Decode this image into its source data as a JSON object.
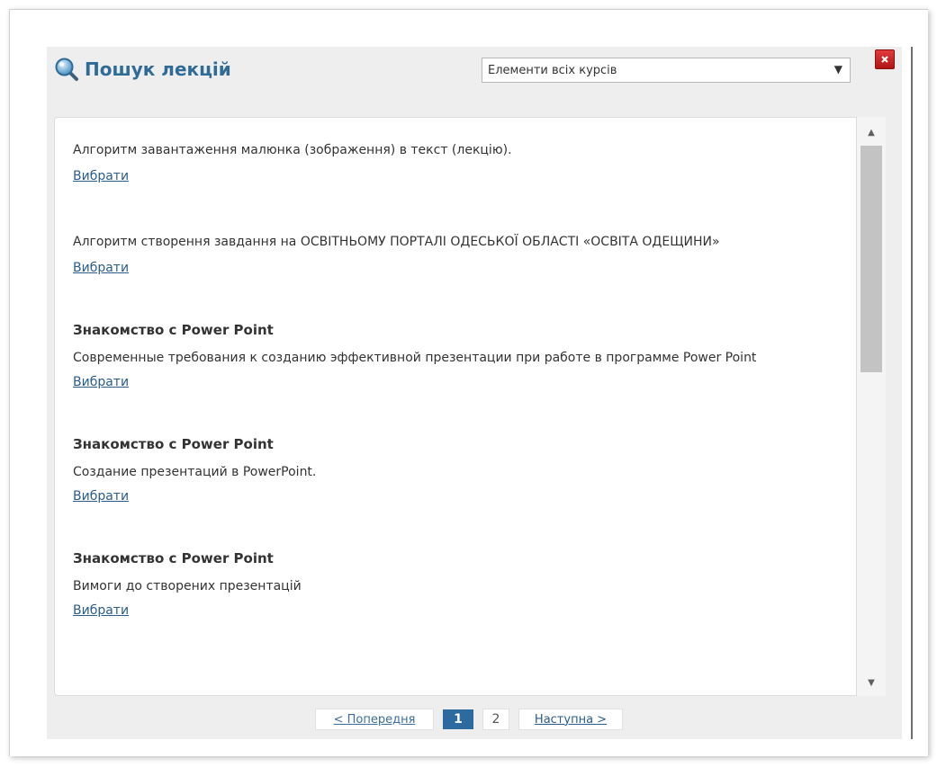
{
  "dialog": {
    "title": "Пошук лекцій",
    "course_filter": {
      "selected": "Елементи всіх курсів"
    }
  },
  "lectures": [
    {
      "title": "",
      "description": "Алгоритм завантаження малюнка (зображення) в текст (лекцію).",
      "select_label": "Вибрати"
    },
    {
      "title": "",
      "description": "Алгоритм створення завдання на ОСВІТНЬОМУ ПОРТАЛІ ОДЕСЬКОЇ ОБЛАСТІ «ОСВІТА ОДЕЩИНИ»",
      "select_label": "Вибрати"
    },
    {
      "title": "Знакомство с Power Point",
      "description": "Современные требования к созданию эффективной презентации при работе в программе Power Point",
      "select_label": "Вибрати"
    },
    {
      "title": "Знакомство с Power Point",
      "description": "Создание презентаций в PowerPoint.",
      "select_label": "Вибрати"
    },
    {
      "title": "Знакомство с Power Point",
      "description": "Вимоги до створених презентацій",
      "select_label": "Вибрати"
    }
  ],
  "pagination": {
    "prev_label": "< Попередня",
    "current_page": "1",
    "other_page": "2",
    "next_label": "Наступна >"
  },
  "colors": {
    "title": "#2e6b97",
    "link": "#2a5d8c",
    "current_page_bg": "#2d6aa0",
    "close_button": "#c62828"
  }
}
